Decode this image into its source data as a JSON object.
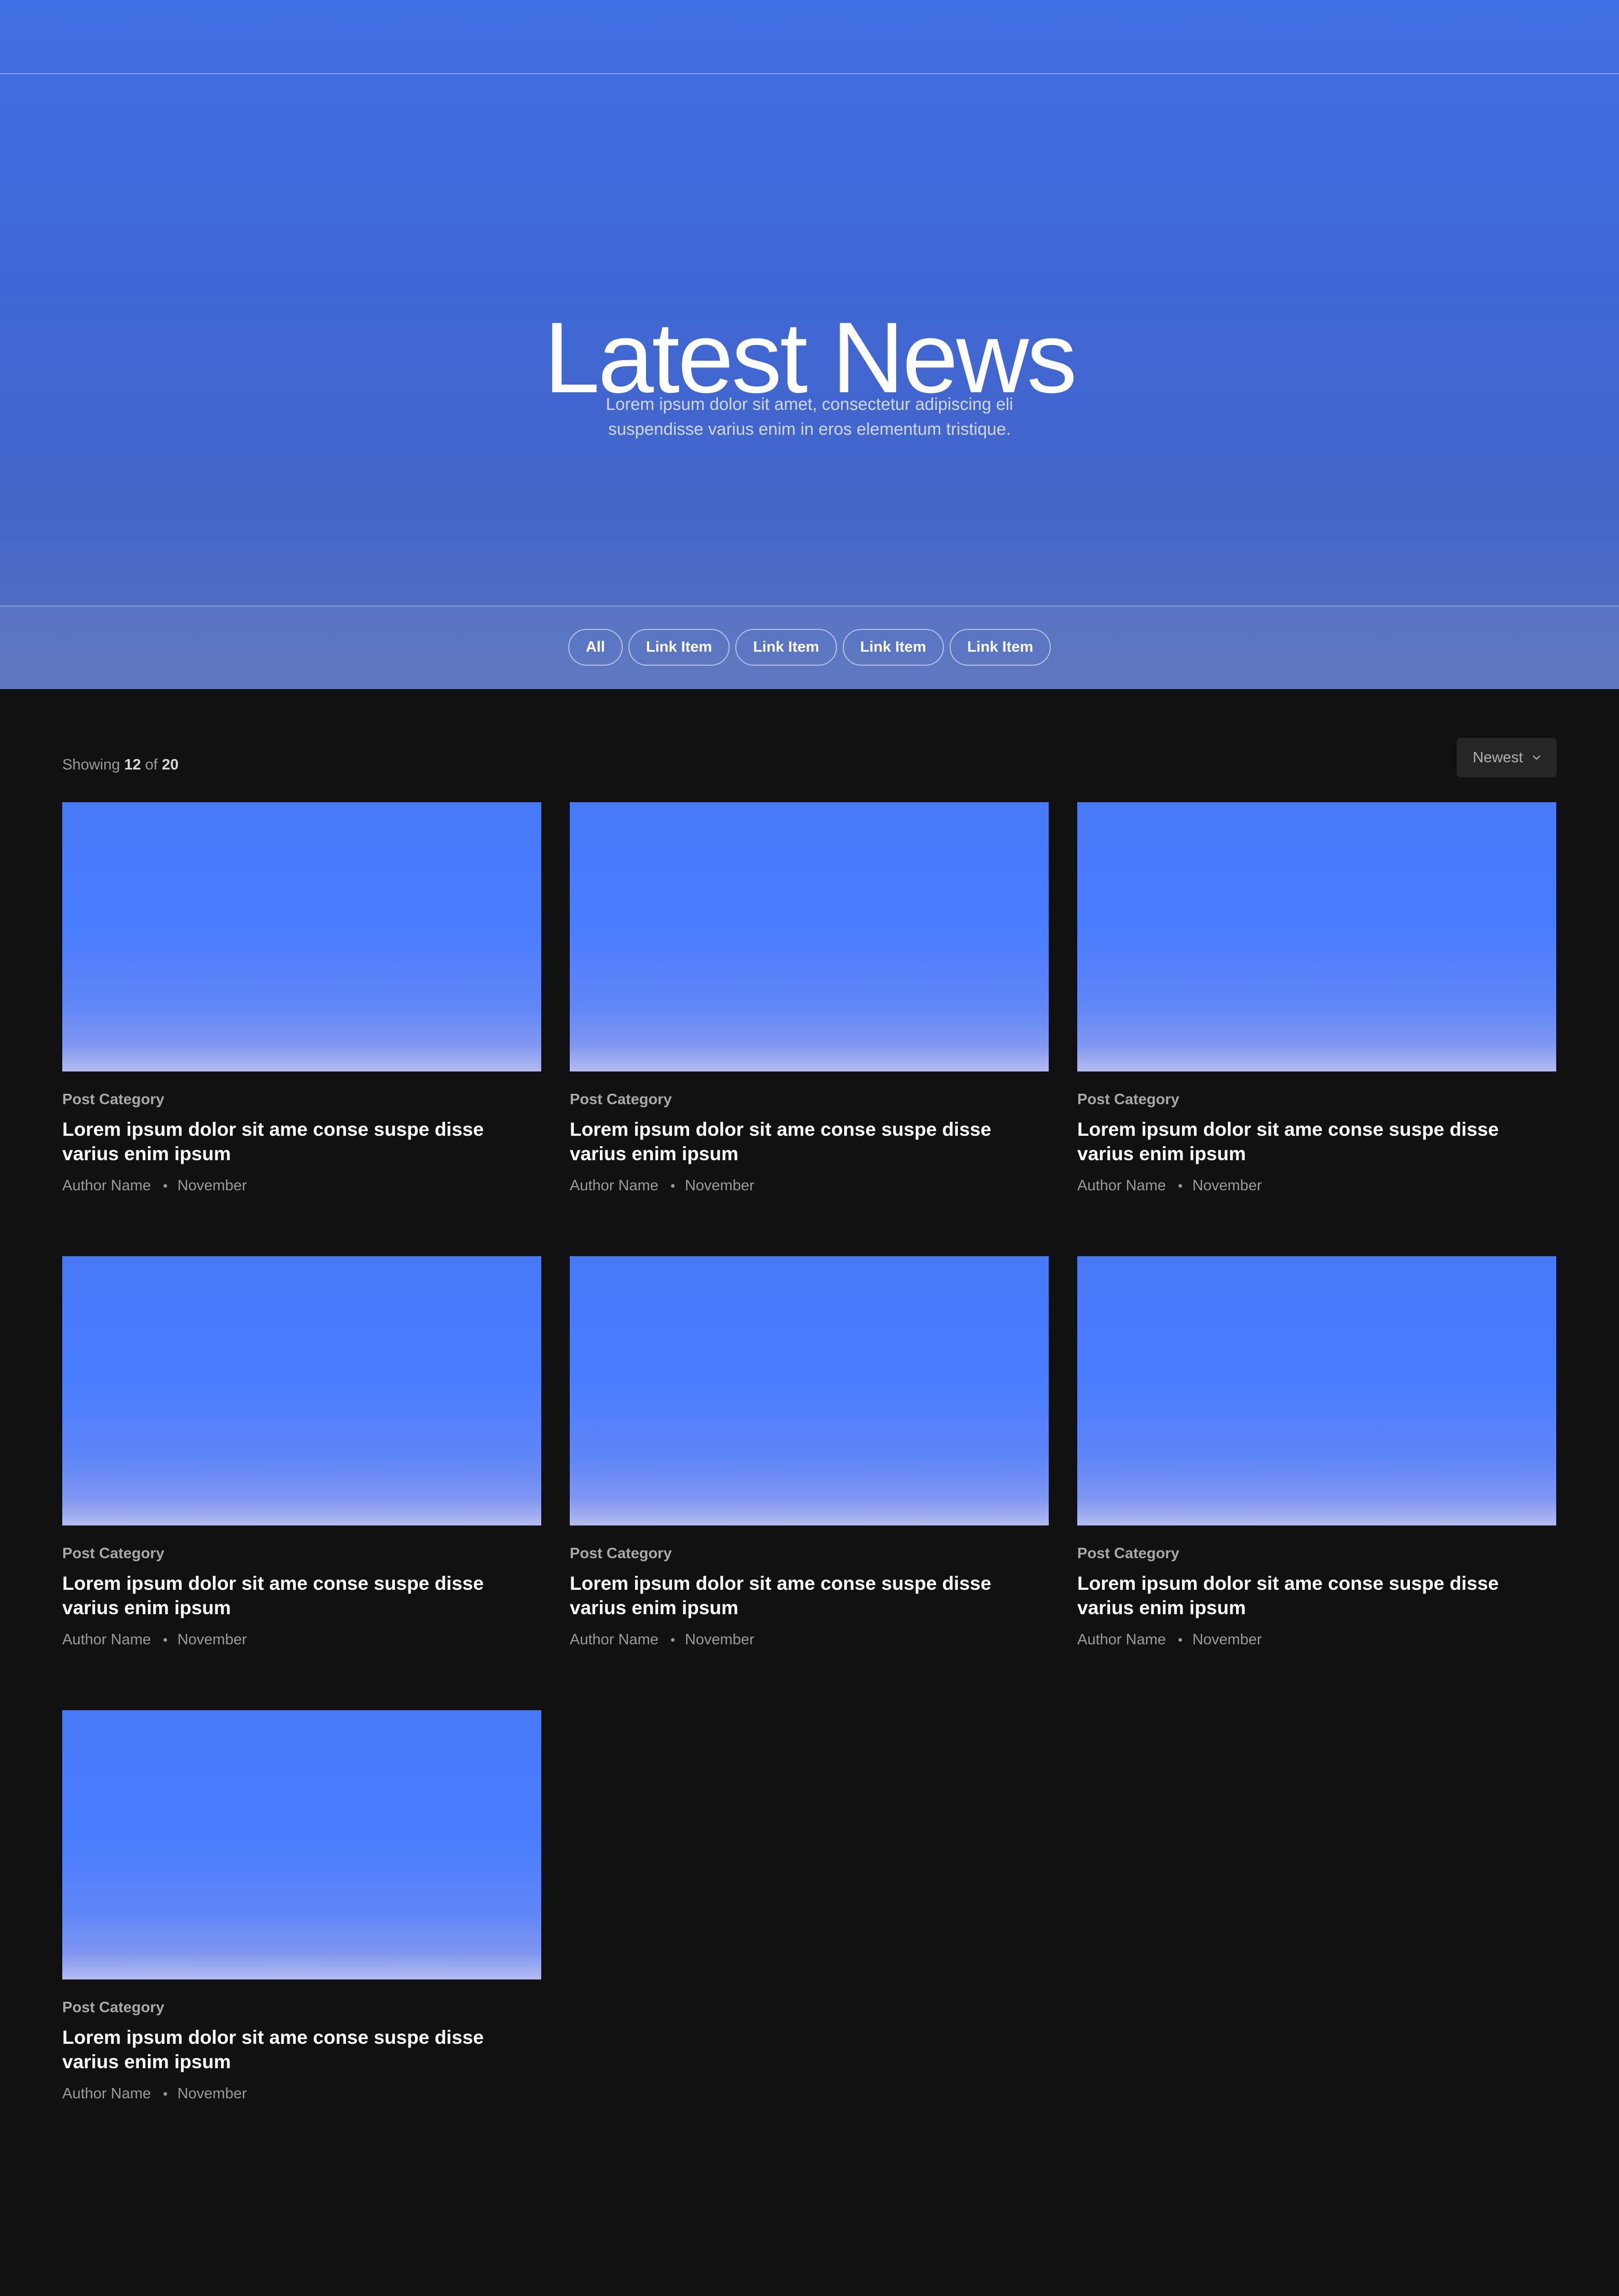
{
  "hero": {
    "title": "Latest News",
    "subtitle": "Lorem ipsum dolor sit amet, consectetur adipiscing eli suspendisse varius enim in eros elementum tristique.",
    "filters": [
      {
        "label": "All"
      },
      {
        "label": "Link Item"
      },
      {
        "label": "Link Item"
      },
      {
        "label": "Link Item"
      },
      {
        "label": "Link Item"
      }
    ]
  },
  "listing": {
    "showing_prefix": "Showing",
    "shown_count": "12",
    "of_word": "of",
    "total_count": "20",
    "sort_label": "Newest"
  },
  "posts": [
    {
      "category": "Post Category",
      "title": "Lorem ipsum dolor sit ame conse suspe disse varius enim ipsum",
      "author": "Author Name",
      "date": "November"
    },
    {
      "category": "Post Category",
      "title": "Lorem ipsum dolor sit ame conse suspe disse varius enim ipsum",
      "author": "Author Name",
      "date": "November"
    },
    {
      "category": "Post Category",
      "title": "Lorem ipsum dolor sit ame conse suspe disse varius enim ipsum",
      "author": "Author Name",
      "date": "November"
    },
    {
      "category": "Post Category",
      "title": "Lorem ipsum dolor sit ame conse suspe disse varius enim ipsum",
      "author": "Author Name",
      "date": "November"
    },
    {
      "category": "Post Category",
      "title": "Lorem ipsum dolor sit ame conse suspe disse varius enim ipsum",
      "author": "Author Name",
      "date": "November"
    },
    {
      "category": "Post Category",
      "title": "Lorem ipsum dolor sit ame conse suspe disse varius enim ipsum",
      "author": "Author Name",
      "date": "November"
    },
    {
      "category": "Post Category",
      "title": "Lorem ipsum dolor sit ame conse suspe disse varius enim ipsum",
      "author": "Author Name",
      "date": "November"
    }
  ],
  "icons": {
    "sort": "chevron-down-icon"
  },
  "colors": {
    "hero_blue": "#3f70e3",
    "page_background": "#111111",
    "thumbnail_blue": "#497cfe"
  }
}
